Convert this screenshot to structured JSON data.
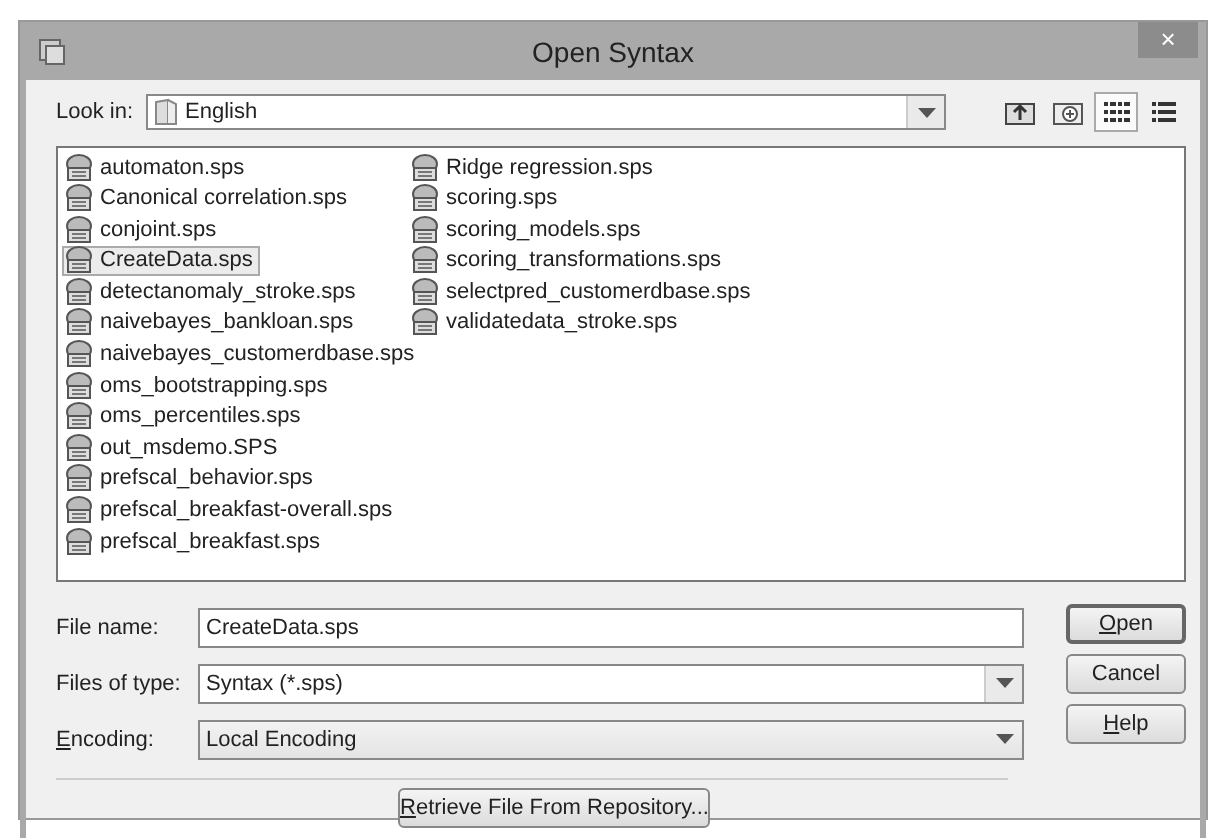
{
  "window": {
    "title": "Open Syntax",
    "close": "×"
  },
  "look_in": {
    "label": "Look in:",
    "value": "English"
  },
  "toolbar": [
    {
      "kind": "up",
      "selected": false
    },
    {
      "kind": "newfolder",
      "selected": false
    },
    {
      "kind": "list",
      "selected": true
    },
    {
      "kind": "details",
      "selected": false
    }
  ],
  "files": [
    {
      "name": "automaton.sps",
      "selected": false
    },
    {
      "name": "Canonical correlation.sps",
      "selected": false
    },
    {
      "name": "conjoint.sps",
      "selected": false
    },
    {
      "name": "CreateData.sps",
      "selected": true
    },
    {
      "name": "detectanomaly_stroke.sps",
      "selected": false
    },
    {
      "name": "naivebayes_bankloan.sps",
      "selected": false
    },
    {
      "name": "naivebayes_customerdbase.sps",
      "selected": false
    },
    {
      "name": "oms_bootstrapping.sps",
      "selected": false
    },
    {
      "name": "oms_percentiles.sps",
      "selected": false
    },
    {
      "name": "out_msdemo.SPS",
      "selected": false
    },
    {
      "name": "prefscal_behavior.sps",
      "selected": false
    },
    {
      "name": "prefscal_breakfast-overall.sps",
      "selected": false
    },
    {
      "name": "prefscal_breakfast.sps",
      "selected": false
    },
    {
      "name": "Ridge regression.sps",
      "selected": false
    },
    {
      "name": "scoring.sps",
      "selected": false
    },
    {
      "name": "scoring_models.sps",
      "selected": false
    },
    {
      "name": "scoring_transformations.sps",
      "selected": false
    },
    {
      "name": "selectpred_customerdbase.sps",
      "selected": false
    },
    {
      "name": "validatedata_stroke.sps",
      "selected": false
    }
  ],
  "fields": [
    {
      "label": "File name:",
      "value": "CreateData.sps",
      "kind": "text",
      "underlined_first": false
    },
    {
      "label": "Files of type:",
      "value": "Syntax (*.sps)",
      "kind": "combo",
      "underlined_first": false
    },
    {
      "label": "Encoding:",
      "value": "Local Encoding",
      "kind": "dropdown",
      "underlined_first": true
    }
  ],
  "buttons": [
    {
      "label": "Open",
      "underlined_first": true,
      "default": true
    },
    {
      "label": "Cancel",
      "underlined_first": false,
      "default": false
    },
    {
      "label": "Help",
      "underlined_first": true,
      "default": false
    }
  ],
  "repository_button": {
    "label": "Retrieve File From Repository...",
    "underlined_first": true
  }
}
